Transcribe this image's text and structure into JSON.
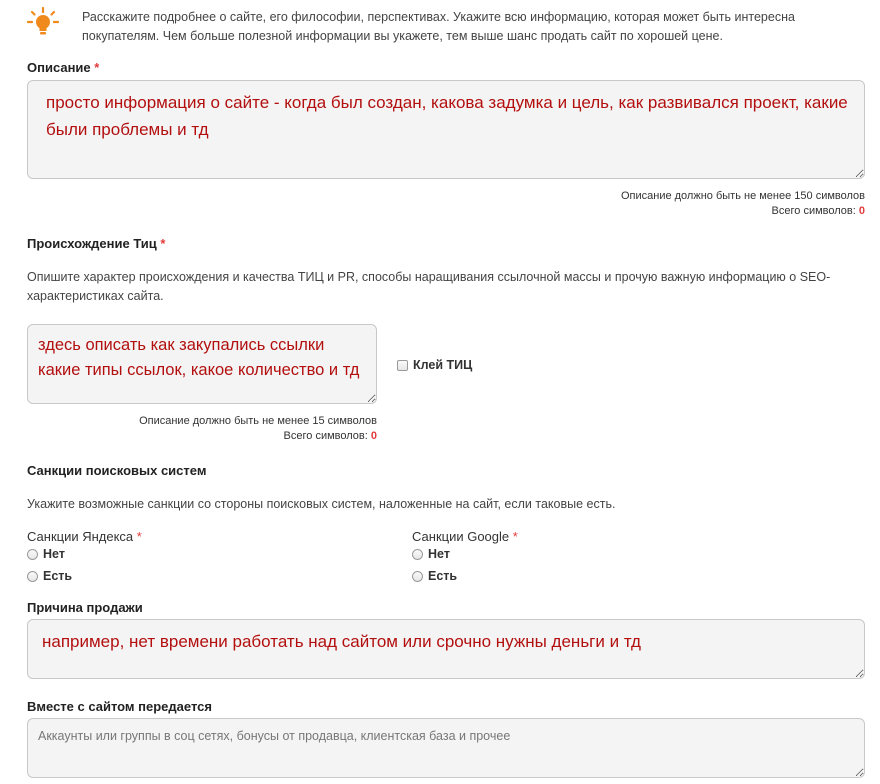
{
  "intro": {
    "icon": "lightbulb-icon",
    "text_line1": "Расскажите подробнее о сайте, его философии, перспективах. Укажите всю информацию, которая может быть интересна",
    "text_line2": "покупателям. Чем больше полезной информации вы укажете, тем выше шанс продать сайт по хорошей цене."
  },
  "description": {
    "label": "Описание",
    "required_mark": "*",
    "value": "просто информация о сайте - когда был создан, какова задумка и цель, как развивался проект, какие были проблемы и тд",
    "min_note": "Описание должно быть не менее 150 символов",
    "count_label": "Всего символов:",
    "count": "0"
  },
  "tic": {
    "label": "Происхождение Тиц",
    "required_mark": "*",
    "hint_line1": "Опишите характер происхождения и качества ТИЦ и PR, способы наращивания ссылочной массы и прочую важную информацию о SEO-",
    "hint_line2": "характеристиках сайта.",
    "value": "здесь описать как закупались ссылки какие типы ссылок, какое количество и тд",
    "checkbox_label": "Клей ТИЦ",
    "min_note": "Описание должно быть не менее 15 символов",
    "count_label": "Всего символов:",
    "count": "0"
  },
  "sanctions": {
    "title": "Санкции поисковых систем",
    "hint": "Укажите возможные санкции со стороны поисковых систем, наложенные на сайт, если таковые есть.",
    "yandex": {
      "label": "Санкции Яндекса",
      "required_mark": "*",
      "options": [
        "Нет",
        "Есть"
      ]
    },
    "google": {
      "label": "Санкции Google",
      "required_mark": "*",
      "options": [
        "Нет",
        "Есть"
      ]
    }
  },
  "reason": {
    "label": "Причина продажи",
    "value": "например, нет времени работать над сайтом или срочно нужны деньги и тд"
  },
  "transfer": {
    "label": "Вместе с сайтом передается",
    "placeholder": "Аккаунты или группы в соц сетях, бонусы от продавца, клиентская база и прочее"
  },
  "colors": {
    "accent": "#f08a1c",
    "required": "#e23c3c",
    "input_text": "#b30f0f"
  }
}
